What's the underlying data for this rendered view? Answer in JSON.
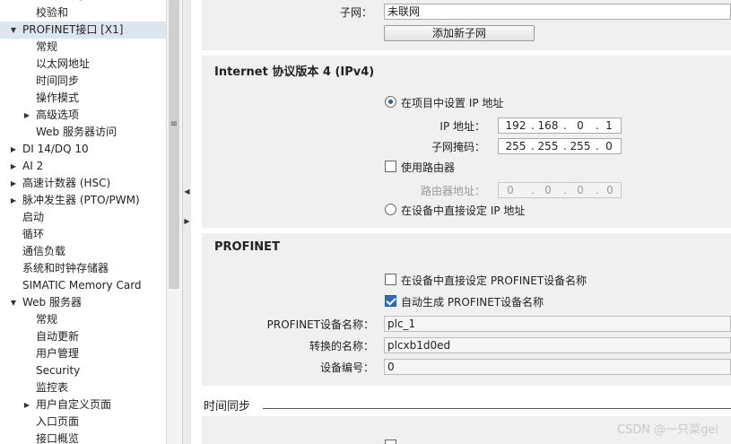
{
  "tree": {
    "items": [
      {
        "label": "标识与维护",
        "indent": 40,
        "arrow": "",
        "selected": false
      },
      {
        "label": "校验和",
        "indent": 40,
        "arrow": "",
        "selected": false
      },
      {
        "label": "PROFINET接口 [X1]",
        "indent": 25,
        "arrow": "▼",
        "selected": true
      },
      {
        "label": "常规",
        "indent": 40,
        "arrow": "",
        "selected": false
      },
      {
        "label": "以太网地址",
        "indent": 40,
        "arrow": "",
        "selected": false
      },
      {
        "label": "时间同步",
        "indent": 40,
        "arrow": "",
        "selected": false
      },
      {
        "label": "操作模式",
        "indent": 40,
        "arrow": "",
        "selected": false
      },
      {
        "label": "高级选项",
        "indent": 40,
        "arrow": "▶",
        "selected": false
      },
      {
        "label": "Web 服务器访问",
        "indent": 40,
        "arrow": "",
        "selected": false
      },
      {
        "label": "DI 14/DQ 10",
        "indent": 25,
        "arrow": "▶",
        "selected": false
      },
      {
        "label": "AI 2",
        "indent": 25,
        "arrow": "▶",
        "selected": false
      },
      {
        "label": "高速计数器 (HSC)",
        "indent": 25,
        "arrow": "▶",
        "selected": false
      },
      {
        "label": "脉冲发生器 (PTO/PWM)",
        "indent": 25,
        "arrow": "▶",
        "selected": false
      },
      {
        "label": "启动",
        "indent": 25,
        "arrow": "",
        "selected": false
      },
      {
        "label": "循环",
        "indent": 25,
        "arrow": "",
        "selected": false
      },
      {
        "label": "通信负载",
        "indent": 25,
        "arrow": "",
        "selected": false
      },
      {
        "label": "系统和时钟存储器",
        "indent": 25,
        "arrow": "",
        "selected": false
      },
      {
        "label": "SIMATIC Memory Card",
        "indent": 25,
        "arrow": "",
        "selected": false
      },
      {
        "label": "Web 服务器",
        "indent": 25,
        "arrow": "▼",
        "selected": false
      },
      {
        "label": "常规",
        "indent": 40,
        "arrow": "",
        "selected": false
      },
      {
        "label": "自动更新",
        "indent": 40,
        "arrow": "",
        "selected": false
      },
      {
        "label": "用户管理",
        "indent": 40,
        "arrow": "",
        "selected": false
      },
      {
        "label": "Security",
        "indent": 40,
        "arrow": "",
        "selected": false
      },
      {
        "label": "监控表",
        "indent": 40,
        "arrow": "",
        "selected": false
      },
      {
        "label": "用户自定义页面",
        "indent": 40,
        "arrow": "▶",
        "selected": false
      },
      {
        "label": "入口页面",
        "indent": 40,
        "arrow": "",
        "selected": false
      },
      {
        "label": "接口概览",
        "indent": 40,
        "arrow": "",
        "selected": false
      }
    ]
  },
  "subnet": {
    "label": "子网：",
    "value": "未联网",
    "add_button": "添加新子网"
  },
  "ipv4": {
    "title": "Internet 协议版本 4 (IPv4)",
    "set_in_project": "在项目中设置 IP 地址",
    "ip_label": "IP 地址：",
    "ip": [
      "192",
      "168",
      "0",
      "1"
    ],
    "mask_label": "子网掩码：",
    "mask": [
      "255",
      "255",
      "255",
      "0"
    ],
    "use_router": "使用路由器",
    "router_label": "路由器地址：",
    "router": [
      "0",
      "0",
      "0",
      "0"
    ],
    "set_on_device": "在设备中直接设定 IP 地址"
  },
  "profinet": {
    "title": "PROFINET",
    "set_name_on_device": "在设备中直接设定 PROFINET设备名称",
    "auto_generate": "自动生成 PROFINET设备名称",
    "device_name_label": "PROFINET设备名称：",
    "device_name": "plc_1",
    "converted_label": "转换的名称：",
    "converted_name": "plcxb1d0ed",
    "device_number_label": "设备编号：",
    "device_number": "0"
  },
  "time_sync": {
    "title": "时间同步"
  },
  "watermark": "CSDN @一只菜gei"
}
